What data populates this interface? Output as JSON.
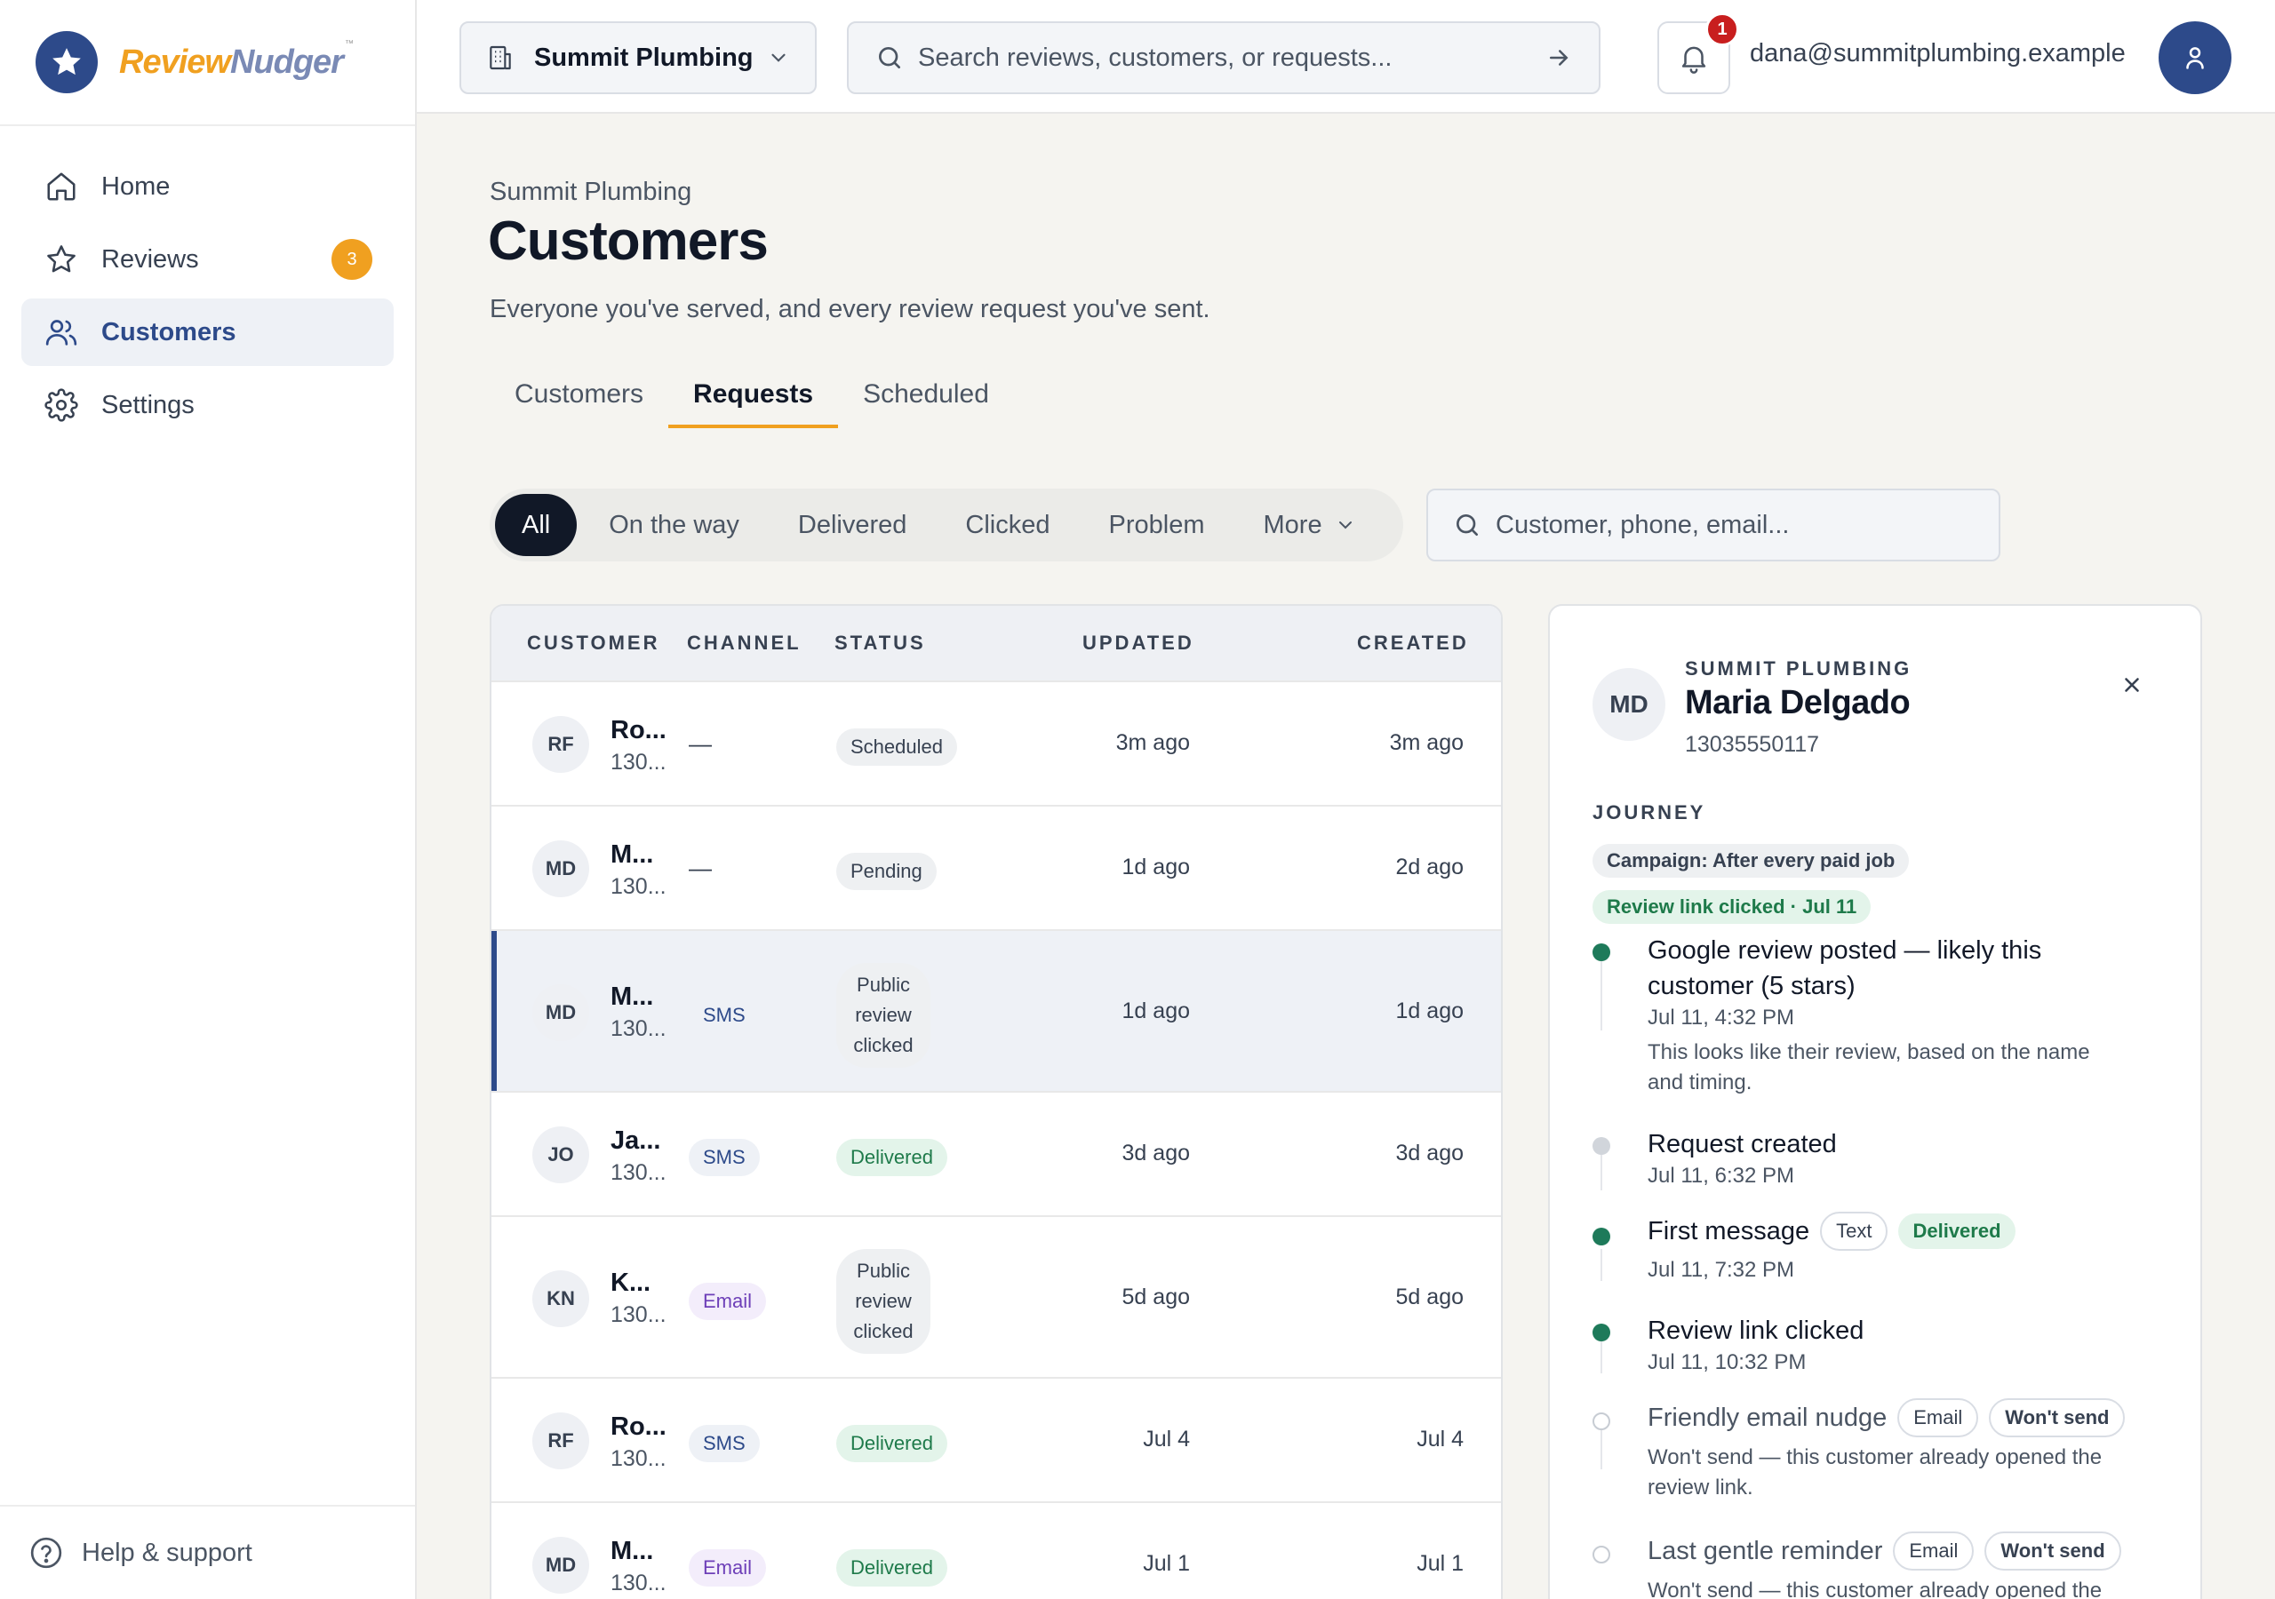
{
  "brand": {
    "name_part1": "Review",
    "name_part2": "Nudger",
    "tm": "™"
  },
  "sidebar": {
    "items": [
      {
        "label": "Home",
        "icon": "home-icon"
      },
      {
        "label": "Reviews",
        "icon": "star-icon",
        "badge": "3"
      },
      {
        "label": "Customers",
        "icon": "users-icon",
        "active": true
      },
      {
        "label": "Settings",
        "icon": "gear-icon"
      }
    ],
    "help": "Help & support"
  },
  "topbar": {
    "company": "Summit Plumbing",
    "search_placeholder": "Search reviews, customers, or requests...",
    "notifications": "1",
    "email": "dana@summitplumbing.example"
  },
  "page": {
    "breadcrumb": "Summit Plumbing",
    "title": "Customers",
    "subtitle": "Everyone you've served, and every review request you've sent.",
    "tabs": [
      "Customers",
      "Requests",
      "Scheduled"
    ],
    "active_tab": "Requests"
  },
  "filters": {
    "chips": [
      "All",
      "On the way",
      "Delivered",
      "Clicked",
      "Problem",
      "More"
    ],
    "search_placeholder": "Customer, phone, email..."
  },
  "table": {
    "headers": [
      "CUSTOMER",
      "CHANNEL",
      "STATUS",
      "UPDATED",
      "CREATED"
    ],
    "rows": [
      {
        "initials": "RF",
        "name": "Ro...",
        "phone": "130...",
        "channel": "—",
        "status": "Scheduled",
        "updated": "3m ago",
        "created": "3m ago"
      },
      {
        "initials": "MD",
        "name": "M...",
        "phone": "130...",
        "channel": "—",
        "status": "Pending",
        "updated": "1d ago",
        "created": "2d ago"
      },
      {
        "initials": "MD",
        "name": "M...",
        "phone": "130...",
        "channel": "SMS",
        "status_lines": [
          "Public",
          "review",
          "clicked"
        ],
        "updated": "1d ago",
        "created": "1d ago"
      },
      {
        "initials": "JO",
        "name": "Ja...",
        "phone": "130...",
        "channel": "SMS",
        "status": "Delivered",
        "updated": "3d ago",
        "created": "3d ago"
      },
      {
        "initials": "KN",
        "name": "K...",
        "phone": "130...",
        "channel": "Email",
        "status_lines": [
          "Public",
          "review",
          "clicked"
        ],
        "updated": "5d ago",
        "created": "5d ago"
      },
      {
        "initials": "RF",
        "name": "Ro...",
        "phone": "130...",
        "channel": "SMS",
        "status": "Delivered",
        "updated": "Jul 4",
        "created": "Jul 4"
      },
      {
        "initials": "MD",
        "name": "M...",
        "phone": "130...",
        "channel": "Email",
        "status": "Delivered",
        "updated": "Jul 1",
        "created": "Jul 1"
      }
    ]
  },
  "panel": {
    "initials": "MD",
    "company": "SUMMIT PLUMBING",
    "name": "Maria Delgado",
    "phone": "13035550117",
    "journey_label": "JOURNEY",
    "campaign_tag": "Campaign: After every paid job",
    "clicked_tag": "Review link clicked · Jul 11",
    "events": [
      {
        "title_l1": "Google review posted — likely this",
        "title_l2": "customer (5 stars)",
        "time": "Jul 11, 4:32 PM",
        "desc_l1": "This looks like their review, based on the name",
        "desc_l2": "and timing."
      },
      {
        "title": "Request created",
        "time": "Jul 11, 6:32 PM"
      },
      {
        "title": "First message",
        "tag1": "Text",
        "tag2": "Delivered",
        "time": "Jul 11, 7:32 PM"
      },
      {
        "title": "Review link clicked",
        "time": "Jul 11, 10:32 PM"
      },
      {
        "title": "Friendly email nudge",
        "tag1": "Email",
        "tag2": "Won't send",
        "desc_l1": "Won't send — this customer already opened the",
        "desc_l2": "review link."
      },
      {
        "title": "Last gentle reminder",
        "tag1": "Email",
        "tag2": "Won't send",
        "desc_l1": "Won't send — this customer already opened the"
      }
    ]
  }
}
